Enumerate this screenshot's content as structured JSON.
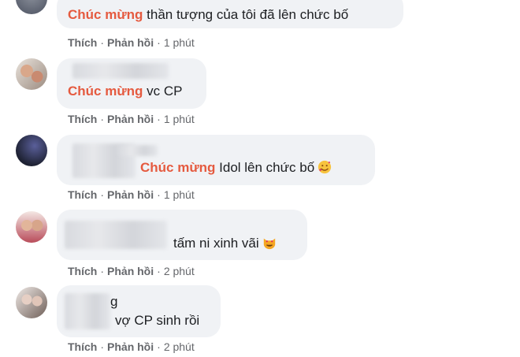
{
  "actions": {
    "like": "Thích",
    "reply": "Phản hồi",
    "sep": "·"
  },
  "comments": [
    {
      "tag": "Chúc mừng",
      "text": " thần tượng của tôi đã lên chức bố",
      "time": "1 phút"
    },
    {
      "tag": "Chúc mừng",
      "text": " vc CP",
      "time": "1 phút"
    },
    {
      "tag": "Chúc mừng",
      "text": " Idol lên chức bố",
      "emoji": "smiling-face-with-hearts",
      "time": "1 phút"
    },
    {
      "tag": "",
      "text": "tấm ni xinh vãi",
      "emoji": "smiling-cat-heart-eyes",
      "time": "2 phút"
    },
    {
      "tag": "",
      "text_line1": "g",
      "text": "vợ CP sinh rồi",
      "time": "2 phút"
    }
  ],
  "colors": {
    "tag": "#e55a3f",
    "bubble": "#f0f2f5",
    "meta": "#65676b"
  }
}
